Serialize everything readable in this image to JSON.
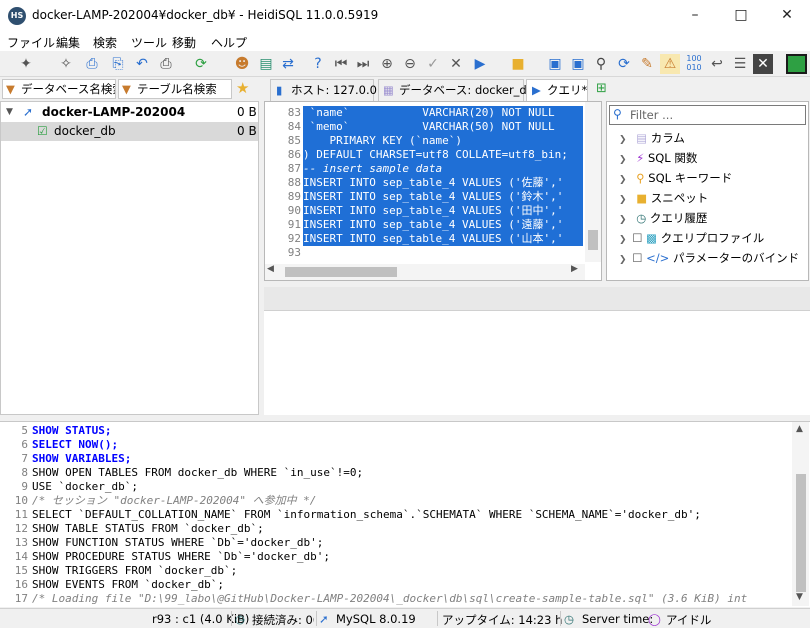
{
  "window": {
    "title": "docker-LAMP-202004¥docker_db¥ - HeidiSQL 11.0.0.5919",
    "icon_text": "HS"
  },
  "menu": [
    "ファイル",
    "編集",
    "検索",
    "ツール",
    "移動",
    "ヘルプ"
  ],
  "search_tabs": {
    "db_search": "データベース名検索",
    "table_search": "テーブル名検索"
  },
  "query_tabs": {
    "host": "ホスト: 127.0.0.1",
    "database": "データベース: docker_db",
    "query": "クエリ*"
  },
  "tree": [
    {
      "name": "docker-LAMP-202004",
      "size": "0 B"
    },
    {
      "name": "docker_db",
      "size": "0 B"
    }
  ],
  "editor": {
    "line_numbers": [
      "83",
      "84",
      "85",
      "86",
      "87",
      "88",
      "89",
      "90",
      "91",
      "92",
      "93"
    ],
    "lines": [
      " `name`           VARCHAR(20) NOT NULL",
      " `memo`           VARCHAR(50) NOT NULL",
      "    PRIMARY KEY (`name`)",
      ") DEFAULT CHARSET=utf8 COLLATE=utf8_bin;",
      "-- insert sample data",
      "INSERT INTO sep_table_4 VALUES ('佐藤','",
      "INSERT INTO sep_table_4 VALUES ('鈴木','",
      "INSERT INTO sep_table_4 VALUES ('田中','",
      "INSERT INTO sep_table_4 VALUES ('遠藤','",
      "INSERT INTO sep_table_4 VALUES ('山本','",
      ""
    ]
  },
  "helper": {
    "filter_placeholder": "Filter ...",
    "items": [
      "カラム",
      "SQL 関数",
      "SQL キーワード",
      "スニペット",
      "クエリ履歴",
      "クエリプロファイル",
      "パラメーターのバインド"
    ]
  },
  "log": {
    "line_numbers": [
      "5",
      "6",
      "7",
      "8",
      "9",
      "10",
      "11",
      "12",
      "13",
      "14",
      "15",
      "16",
      "17"
    ],
    "lines": [
      "SHOW STATUS;",
      "SELECT NOW();",
      "SHOW VARIABLES;",
      "SHOW OPEN TABLES FROM docker_db WHERE `in_use`!=0;",
      "USE `docker_db`;",
      "/* セッション \"docker-LAMP-202004\" へ参加中 */",
      "SELECT `DEFAULT_COLLATION_NAME` FROM `information_schema`.`SCHEMATA` WHERE `SCHEMA_NAME`='docker_db';",
      "SHOW TABLE STATUS FROM `docker_db`;",
      "SHOW FUNCTION STATUS WHERE `Db`='docker_db';",
      "SHOW PROCEDURE STATUS WHERE `Db`='docker_db';",
      "SHOW TRIGGERS FROM `docker_db`;",
      "SHOW EVENTS FROM `docker_db`;",
      "/* Loading file \"D:\\99_labo\\@GitHub\\Docker-LAMP-202004\\_docker\\db\\sql\\create-sample-table.sql\" (3.6 KiB) int"
    ]
  },
  "status": {
    "cursor": "r93 : c1 (4.0 KiB)",
    "connected": "接続済み: 00",
    "server": "MySQL 8.0.19",
    "uptime": "アップタイム: 14:23 h",
    "server_time": "Server time:",
    "idle": "アイドル"
  },
  "colors": {
    "selection": "#1f6fd6",
    "keyword": "#0000ff",
    "string": "#008080",
    "comment": "#808080",
    "accent_green": "#2ea043"
  }
}
